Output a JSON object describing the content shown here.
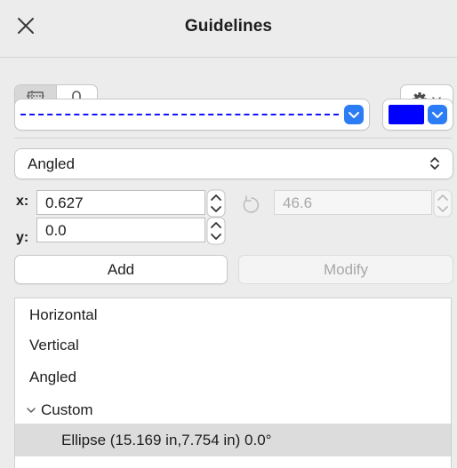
{
  "window": {
    "title": "Guidelines"
  },
  "icons": {
    "close": "close-icon",
    "guides_mode": "guidelines-frame-icon",
    "snap_mode": "snap-object-icon",
    "settings": "gear-icon",
    "rotate": "rotate-icon"
  },
  "line_style": {
    "pattern": "dashed",
    "color": "#1212ff"
  },
  "guide_color": {
    "value": "#0000ff"
  },
  "guide_type": {
    "selected": "Angled"
  },
  "fields": {
    "x_label": "x:",
    "x_value": "0.627",
    "y_label": "y:",
    "y_value": "0.0",
    "angle_value": "46.6"
  },
  "buttons": {
    "add": "Add",
    "modify": "Modify"
  },
  "guides_list": {
    "items": [
      {
        "label": "Horizontal"
      },
      {
        "label": "Vertical"
      },
      {
        "label": "Angled"
      },
      {
        "label": "Custom",
        "expanded": true
      },
      {
        "label": "Ellipse (15.169 in,7.754 in) 0.0°",
        "selected": true
      }
    ]
  },
  "colors": {
    "accent": "#2c7cf6",
    "selection": "#dcdcdc"
  }
}
